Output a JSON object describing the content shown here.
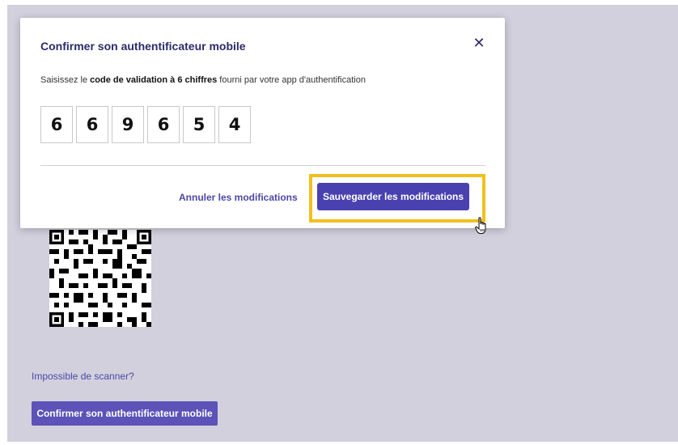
{
  "background": {
    "cant_scan_link": "Impossible de scanner?",
    "confirm_button": "Confirmer son authentificateur mobile"
  },
  "modal": {
    "title": "Confirmer son authentificateur mobile",
    "close_icon": "close-icon",
    "instruction_prefix": "Saisissez le ",
    "instruction_bold": "code de validation à 6 chiffres",
    "instruction_suffix": " fourni par votre app d'authentification",
    "code_digits": [
      "6",
      "6",
      "9",
      "6",
      "5",
      "4"
    ],
    "cancel_label": "Annuler les modifications",
    "save_label": "Sauvegarder les modifications"
  },
  "colors": {
    "page_background": "#d2d0dd",
    "primary_button": "#4a41b0",
    "link": "#4d47a6",
    "title": "#2c2a6b",
    "highlight": "#f2c01e"
  }
}
